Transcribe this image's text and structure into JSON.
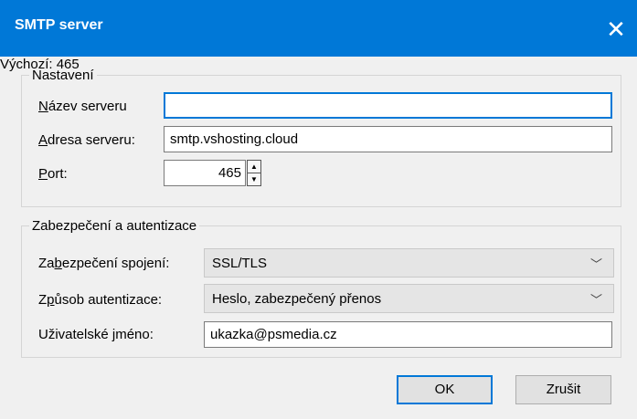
{
  "window": {
    "title": "SMTP server",
    "close_label": "✕"
  },
  "settings": {
    "legend": "Nastavení",
    "server_name": {
      "label_accel": "N",
      "label_rest": "ázev serveru",
      "value": ""
    },
    "server_address": {
      "label_accel": "A",
      "label_rest": "dresa serveru:",
      "value": "smtp.vshosting.cloud"
    },
    "port": {
      "label_accel": "P",
      "label_rest": "ort:",
      "value": "465",
      "default_label": "Výchozí:",
      "default_value": "465"
    }
  },
  "security": {
    "legend": "Zabezpečení a autentizace",
    "connection": {
      "label_pre": "Za",
      "label_accel": "b",
      "label_rest": "ezpečení spojení:",
      "value": "SSL/TLS"
    },
    "auth": {
      "label_pre": "Z",
      "label_accel": "p",
      "label_rest": "ůsob autentizace:",
      "value": "Heslo, zabezpečený přenos"
    },
    "username": {
      "label_pre": "Uživatelské ",
      "label_accel": "j",
      "label_rest": "méno:",
      "value": "ukazka@psmedia.cz"
    }
  },
  "buttons": {
    "ok": "OK",
    "cancel": "Zrušit"
  }
}
